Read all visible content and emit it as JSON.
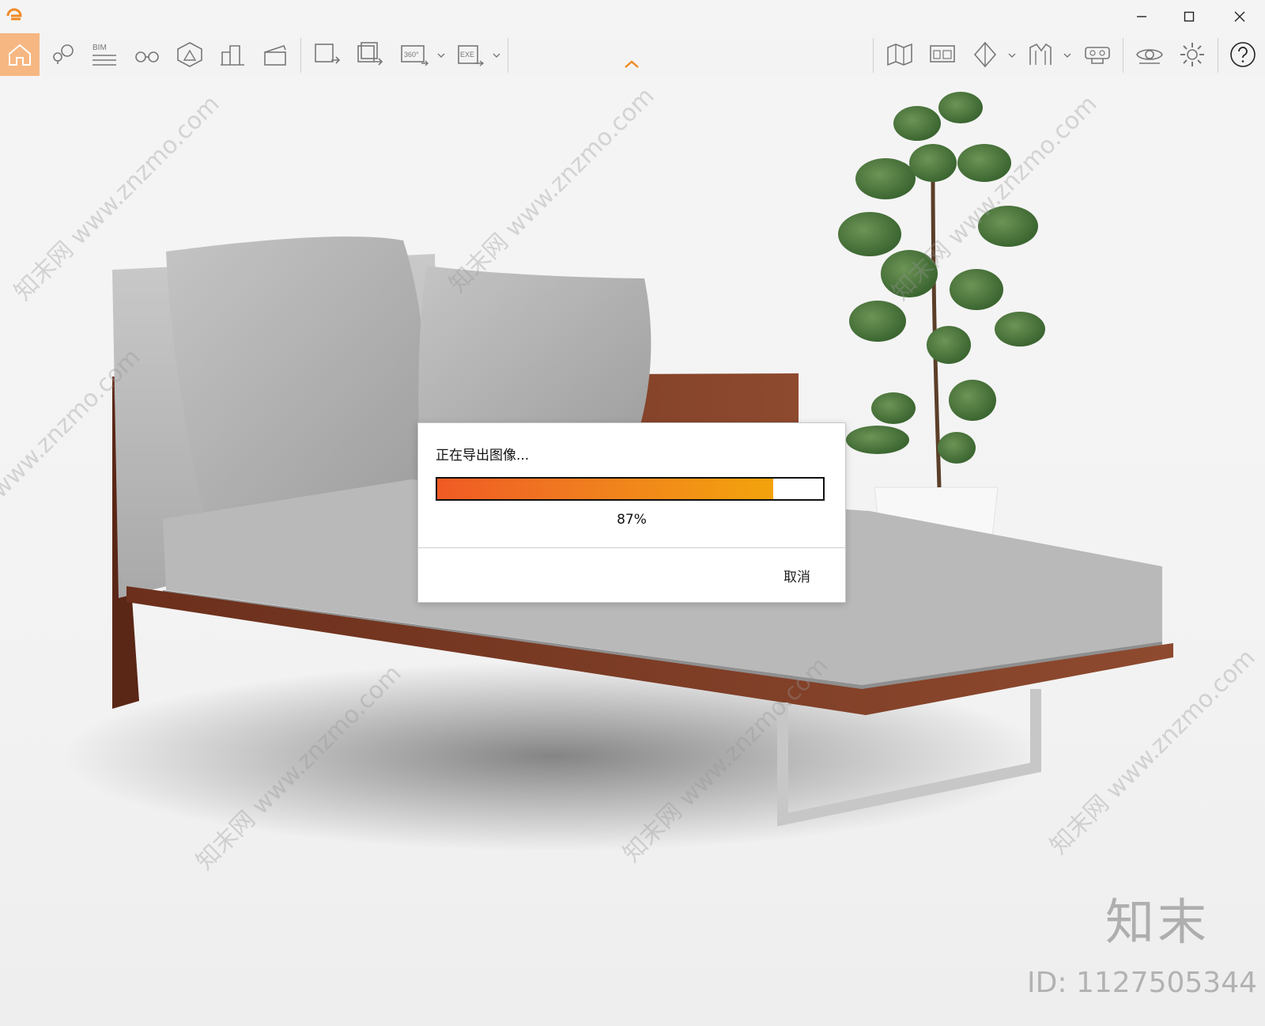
{
  "window": {
    "minimize_icon": "minimize-icon",
    "maximize_icon": "maximize-icon",
    "close_icon": "close-icon",
    "logo_icon": "app-logo-icon",
    "accent": "#f08a24"
  },
  "toolbar": {
    "bim_label": "BIM",
    "pano_label": "360°",
    "exe_label": "EXE",
    "active_color": "#f6b783"
  },
  "dialog": {
    "title": "正在导出图像...",
    "progress": 87,
    "progress_text": "87%",
    "cancel_label": "取消"
  },
  "overlay": {
    "watermark_text": "知末网 www.znzmo.com",
    "brand_mark": "知末",
    "brand_id": "ID: 1127505344"
  }
}
